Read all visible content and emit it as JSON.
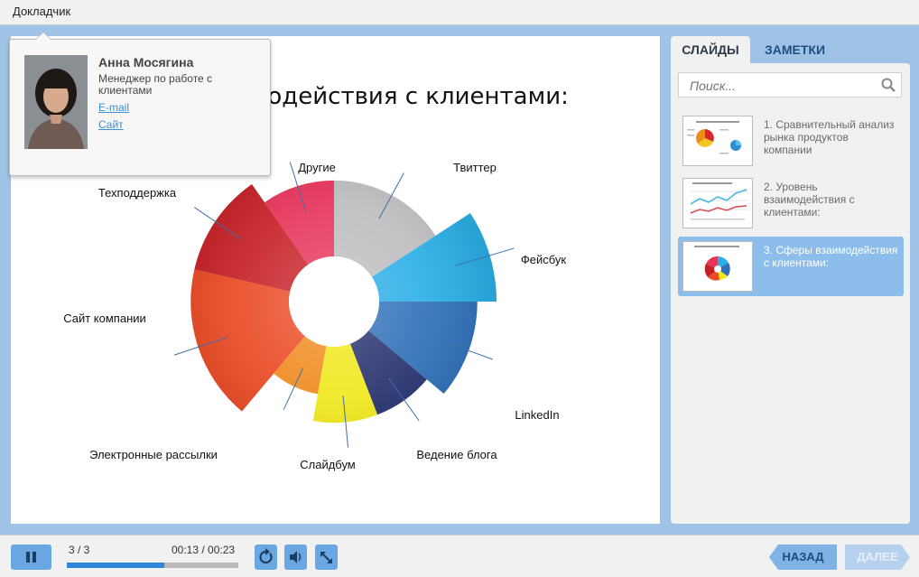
{
  "topbar": {
    "presenter_tab": "Докладчик"
  },
  "slide": {
    "title": "Сферы взаимодействия с клиентами:",
    "chart_data": {
      "type": "pie",
      "variant": "polar-area",
      "categories": [
        "Другие",
        "Твиттер",
        "Фейсбук",
        "LinkedIn",
        "Ведение блога",
        "Слайдбум",
        "Электронные рассылки",
        "Сайт компании",
        "Техподдержка"
      ],
      "values": [
        5,
        9,
        7,
        5,
        5,
        3,
        7,
        7,
        5
      ],
      "colors": [
        "#bdbdbf",
        "#2aaee6",
        "#2f6fb8",
        "#25306e",
        "#f1e81c",
        "#f08a1e",
        "#ea4a24",
        "#c62026",
        "#e6335a"
      ]
    }
  },
  "sidebar": {
    "tabs": {
      "slides": "СЛАЙДЫ",
      "notes": "ЗАМЕТКИ"
    },
    "search": {
      "placeholder": "Поиск..."
    },
    "slides": [
      {
        "label": "1. Сравнительный анализ рынка продуктов компании"
      },
      {
        "label": "2. Уровень взаимодействия с клиентами:"
      },
      {
        "label": "3. Сферы взаимодействия с клиентами:"
      }
    ]
  },
  "player": {
    "counter": "3 / 3",
    "time": "00:13 / 00:23",
    "progress": 0.57,
    "back_label": "НАЗАД",
    "next_label": "ДАЛЕЕ"
  },
  "presenter": {
    "name": "Анна Мосягина",
    "role": "Менеджер по работе с клиентами",
    "email": "E-mail",
    "site": "Сайт"
  }
}
